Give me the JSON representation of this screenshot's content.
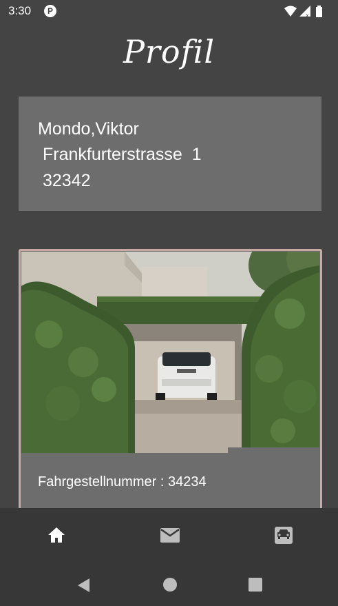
{
  "status_bar": {
    "time": "3:30",
    "app_icon": "P",
    "icons": [
      "wifi-icon",
      "signal-icon",
      "battery-icon"
    ]
  },
  "page": {
    "title": "Profil"
  },
  "profile": {
    "name": "Mondo,Viktor",
    "street": "Frankfurterstrasse  1",
    "zip": "32342"
  },
  "vehicle": {
    "vin_label": "Fahrgestellnummer : 34234",
    "photo_icon": "car-in-garage-photo"
  },
  "bottom_nav": {
    "items": [
      "home-icon",
      "mail-icon",
      "car-icon"
    ]
  },
  "system_nav": {
    "items": [
      "back-icon",
      "home-circle-icon",
      "recents-icon"
    ]
  },
  "colors": {
    "background": "#444444",
    "card": "#6d6d6d",
    "nav": "#373737",
    "card_border": "#c9a9a3",
    "text": "#ffffff"
  }
}
